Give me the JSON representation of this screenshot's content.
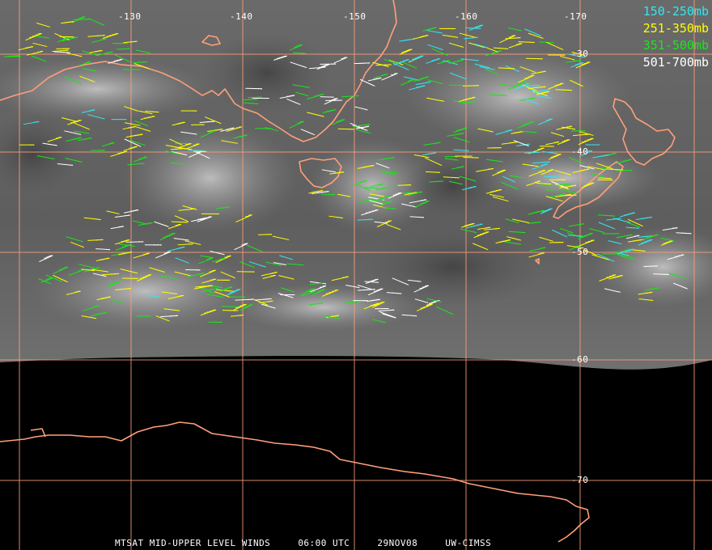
{
  "colors": {
    "coast": "#ff9f7a",
    "grid": "#ff9f7a",
    "label": "#ffffff",
    "space": "#000000"
  },
  "longitude_labels": [
    "-130",
    "-140",
    "-150",
    "-160",
    "-170"
  ],
  "latitude_labels": [
    "-30",
    "-40",
    "-50",
    "-60",
    "-70"
  ],
  "legend": [
    {
      "label": "150-250mb",
      "color": "#33e6f0"
    },
    {
      "label": "251-350mb",
      "color": "#ffff00"
    },
    {
      "label": "351-500mb",
      "color": "#19e619"
    },
    {
      "label": "501-700mb",
      "color": "#ffffff"
    }
  ],
  "footer": {
    "product": "MTSAT MID-UPPER LEVEL WINDS",
    "time": "06:00 UTC",
    "date": "29NOV08",
    "source": "UW-CIMSS"
  }
}
